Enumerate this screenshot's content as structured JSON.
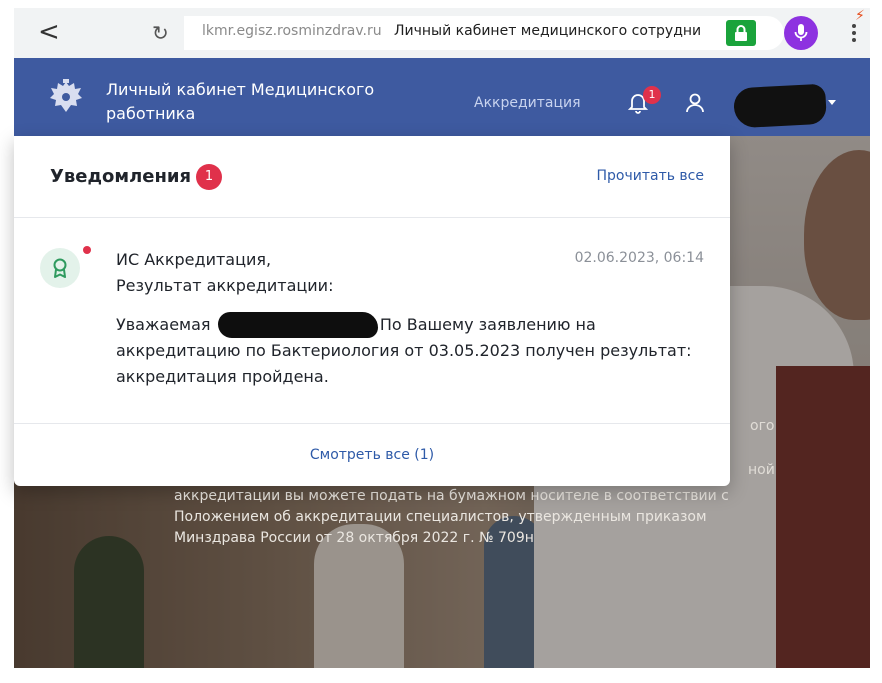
{
  "browser": {
    "url_domain": "lkmr.egisz.rosminzdrav.ru",
    "url_title": "Личный кабинет медицинского сотрудни",
    "back_glyph": "<",
    "reload_glyph": "↻"
  },
  "header": {
    "site_title": "Личный кабинет Медицинского работника",
    "nav_accreditation": "Аккредитация",
    "bell_count": "1"
  },
  "notifications": {
    "title": "Уведомления",
    "count": "1",
    "read_all": "Прочитать все",
    "items": [
      {
        "source": "ИС Аккредитация,",
        "subject": "Результат аккредитации:",
        "date": "02.06.2023, 06:14",
        "body_prefix": "Уважаемая",
        "body_suffix": "а! По Вашему заявлению на аккредитацию по Бактериология от 03.05.2023 получен результат: аккредитация пройдена."
      }
    ],
    "view_all": "Смотреть все (1)"
  },
  "hero": {
    "text": "аккредитации вы можете подать на бумажном носителе в соответствии с Положением об аккредитации специалистов, утвержденным приказом Минздрава России от 28 октября 2022 г. № 709н",
    "peek_1": "ого",
    "peek_2": "ной"
  },
  "colors": {
    "header_bg": "#3e5aa0",
    "accent_link": "#2e5aa8",
    "badge_red": "#e0314b",
    "secure_green": "#1aa33b",
    "mic_purple": "#8d32e0"
  },
  "icons": {
    "back": "chevron-left-icon",
    "reload": "reload-icon",
    "lock": "lock-icon",
    "mic": "microphone-icon",
    "menu": "more-vertical-icon",
    "emblem": "double-headed-eagle-emblem-icon",
    "bell": "bell-icon",
    "user": "user-icon",
    "award": "award-ribbon-icon"
  }
}
